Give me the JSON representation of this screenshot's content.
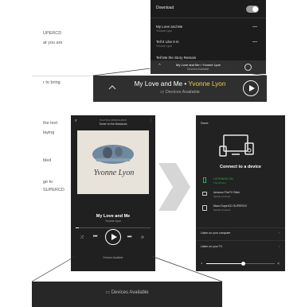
{
  "left_text": {
    "line1": "UPERCD",
    "line2": "at you are",
    "line3": "r to bring",
    "line4": "the text",
    "line5": "laying",
    "line6": "bled",
    "line7": "ge to",
    "line8": "SUPERCD"
  },
  "top_panel": {
    "download_label": "Download",
    "item1_title": "My Love and Me",
    "item1_sub": "Yvonne Lyon",
    "item2_title": "Tell It Like It Is",
    "item2_sub": "Yvonne Lyon",
    "item3_title": "Tell Me the Story Remain",
    "mini_np_title": "My Love and Me • Yvonne Lyon",
    "mini_np_sub": "Devices Available"
  },
  "callout": {
    "song": "My Love and Me",
    "separator": " • ",
    "artist": "Yvonne Lyon",
    "devices": "Devices Available"
  },
  "player": {
    "header_line1": "PLAYING FROM ALBUM",
    "header_line2": "Tower to the Meadows",
    "album_text": "Yvonne Lyon",
    "song_title": "My Love and Me",
    "artist": "Yvonne Lyon",
    "devices": "Devices Available"
  },
  "connect": {
    "done": "Done",
    "title": "Connect to a device",
    "device1_name": "LISTENING ON",
    "device1_sub": "This iPhone",
    "device2_name": "Amazon FireTV Stick",
    "device2_sub": "Spotify Connect",
    "device3_name": "Marci SuperCD SUPERCD",
    "device3_sub": "Spotify Connect",
    "menu1": "Listen on your computer",
    "menu2": "Listen on your TV"
  },
  "bottom_bar": {
    "devices": "Devices Available"
  },
  "colors": {
    "accent_yellow": "#f2c94c",
    "spotify_green": "#1db954"
  }
}
